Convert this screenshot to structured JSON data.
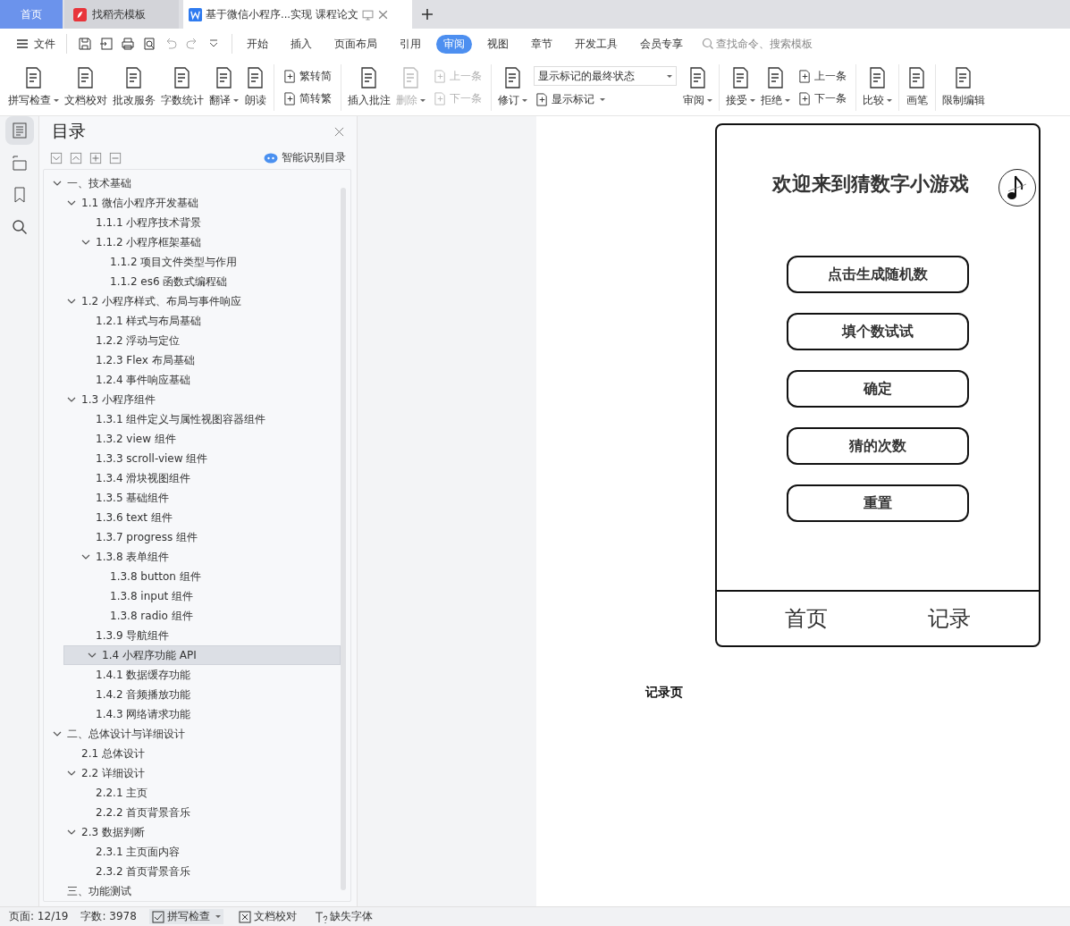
{
  "tabs": [
    {
      "label": "首页",
      "kind": "home",
      "selected": false
    },
    {
      "label": "找稻壳模板",
      "kind": "app",
      "selected": false
    },
    {
      "label": "基于微信小程序...实现 课程论文",
      "kind": "doc",
      "selected": true
    }
  ],
  "menu": {
    "file": "文件",
    "ribbon_tabs": [
      {
        "label": "开始",
        "selected": false
      },
      {
        "label": "插入",
        "selected": false
      },
      {
        "label": "页面布局",
        "selected": false
      },
      {
        "label": "引用",
        "selected": false
      },
      {
        "label": "审阅",
        "selected": true
      },
      {
        "label": "视图",
        "selected": false
      },
      {
        "label": "章节",
        "selected": false
      },
      {
        "label": "开发工具",
        "selected": false
      },
      {
        "label": "会员专享",
        "selected": false
      }
    ],
    "search": {
      "placeholder": "查找命令、搜索模板"
    }
  },
  "toolbar": [
    {
      "kind": "big",
      "label": "拼写检查",
      "caret": true,
      "disabled": false
    },
    {
      "kind": "big",
      "label": "文档校对",
      "caret": false,
      "disabled": false
    },
    {
      "kind": "big",
      "label": "批改服务",
      "caret": false,
      "disabled": false
    },
    {
      "kind": "big",
      "label": "字数统计",
      "caret": false,
      "disabled": false
    },
    {
      "kind": "big",
      "label": "翻译",
      "caret": true,
      "disabled": false
    },
    {
      "kind": "big",
      "label": "朗读",
      "caret": false,
      "disabled": false
    },
    {
      "kind": "sep"
    },
    {
      "kind": "pair",
      "items": [
        {
          "label": "繁转简",
          "disabled": false
        },
        {
          "label": "简转繁",
          "disabled": false
        }
      ]
    },
    {
      "kind": "sep"
    },
    {
      "kind": "big",
      "label": "插入批注",
      "caret": false,
      "disabled": false
    },
    {
      "kind": "big",
      "label": "删除",
      "caret": true,
      "disabled": true
    },
    {
      "kind": "pair",
      "items": [
        {
          "label": "上一条",
          "disabled": true
        },
        {
          "label": "下一条",
          "disabled": true
        }
      ]
    },
    {
      "kind": "sep"
    },
    {
      "kind": "big",
      "label": "修订",
      "caret": true,
      "disabled": false
    },
    {
      "kind": "select",
      "value": "显示标记的最终状态",
      "label": "显示标记"
    },
    {
      "kind": "big",
      "label": "审阅",
      "caret": true,
      "disabled": false
    },
    {
      "kind": "sep"
    },
    {
      "kind": "big",
      "label": "接受",
      "caret": true,
      "disabled": false
    },
    {
      "kind": "big",
      "label": "拒绝",
      "caret": true,
      "disabled": false
    },
    {
      "kind": "pair",
      "items": [
        {
          "label": "上一条",
          "disabled": false
        },
        {
          "label": "下一条",
          "disabled": false
        }
      ]
    },
    {
      "kind": "sep"
    },
    {
      "kind": "big",
      "label": "比较",
      "caret": true,
      "disabled": false
    },
    {
      "kind": "sep"
    },
    {
      "kind": "big",
      "label": "画笔",
      "caret": false,
      "disabled": false
    },
    {
      "kind": "sep"
    },
    {
      "kind": "big",
      "label": "限制编辑",
      "caret": false,
      "disabled": false
    }
  ],
  "toc": {
    "title": "目录",
    "smart_button": "智能识别目录",
    "items": [
      {
        "label": "一、技术基础",
        "expanded": true,
        "selected": false,
        "children": [
          {
            "label": "1.1  微信小程序开发基础",
            "expanded": true,
            "selected": false,
            "children": [
              {
                "label": "1.1.1  小程序技术背景",
                "selected": false
              },
              {
                "label": "1.1.2  小程序框架基础",
                "expanded": true,
                "selected": false,
                "children": [
                  {
                    "label": "1.1.2  项目文件类型与作用",
                    "selected": false
                  },
                  {
                    "label": "1.1.2 es6  函数式编程础",
                    "selected": false
                  }
                ]
              }
            ]
          },
          {
            "label": "1.2  小程序样式、布局与事件响应",
            "expanded": true,
            "selected": false,
            "children": [
              {
                "label": "1.2.1  样式与布局基础",
                "selected": false
              },
              {
                "label": "1.2.2  浮动与定位",
                "selected": false
              },
              {
                "label": "1.2.3 Flex  布局基础",
                "selected": false
              },
              {
                "label": "1.2.4  事件响应基础",
                "selected": false
              }
            ]
          },
          {
            "label": "1.3  小程序组件",
            "expanded": true,
            "selected": false,
            "children": [
              {
                "label": "1.3.1  组件定义与属性视图容器组件",
                "selected": false
              },
              {
                "label": "1.3.2 view  组件",
                "selected": false
              },
              {
                "label": "1.3.3 scroll-view  组件",
                "selected": false
              },
              {
                "label": "1.3.4  滑块视图组件",
                "selected": false
              },
              {
                "label": "1.3.5  基础组件",
                "selected": false
              },
              {
                "label": "1.3.6 text  组件",
                "selected": false
              },
              {
                "label": "1.3.7 progress  组件",
                "selected": false
              },
              {
                "label": "1.3.8  表单组件",
                "expanded": true,
                "selected": false,
                "children": [
                  {
                    "label": "1.3.8 button  组件",
                    "selected": false
                  },
                  {
                    "label": "1.3.8 input  组件",
                    "selected": false
                  },
                  {
                    "label": "1.3.8 radio  组件",
                    "selected": false
                  }
                ]
              },
              {
                "label": "1.3.9  导航组件",
                "selected": false
              }
            ]
          },
          {
            "label": "1.4  小程序功能  API",
            "expanded": true,
            "selected": true,
            "children": [
              {
                "label": "1.4.1  数据缓存功能",
                "selected": false
              },
              {
                "label": "1.4.2  音频播放功能",
                "selected": false
              },
              {
                "label": "1.4.3  网络请求功能",
                "selected": false
              }
            ]
          }
        ]
      },
      {
        "label": "二、总体设计与详细设计",
        "expanded": true,
        "selected": false,
        "children": [
          {
            "label": "2.1  总体设计",
            "selected": false
          },
          {
            "label": "2.2  详细设计",
            "expanded": true,
            "selected": false,
            "children": [
              {
                "label": "2.2.1  主页",
                "selected": false
              },
              {
                "label": "2.2.2  首页背景音乐",
                "selected": false
              }
            ]
          },
          {
            "label": "2.3  数据判断",
            "expanded": true,
            "selected": false,
            "children": [
              {
                "label": "2.3.1  主页面内容",
                "selected": false
              },
              {
                "label": "2.3.2  首页背景音乐",
                "selected": false
              }
            ]
          }
        ]
      },
      {
        "label": "三、功能测试",
        "selected": false
      }
    ]
  },
  "document": {
    "mockup": {
      "title": "欢迎来到猜数字小游戏",
      "buttons": [
        "点击生成随机数",
        "填个数试试",
        "确定",
        "猜的次数",
        "重置"
      ],
      "tabbar": [
        "首页",
        "记录"
      ]
    },
    "caption": "记录页"
  },
  "status_bar": {
    "page": "页面: 12/19",
    "words": "字数: 3978",
    "spell": "拼写检查",
    "proof": "文档校对",
    "fonts": "缺失字体"
  }
}
